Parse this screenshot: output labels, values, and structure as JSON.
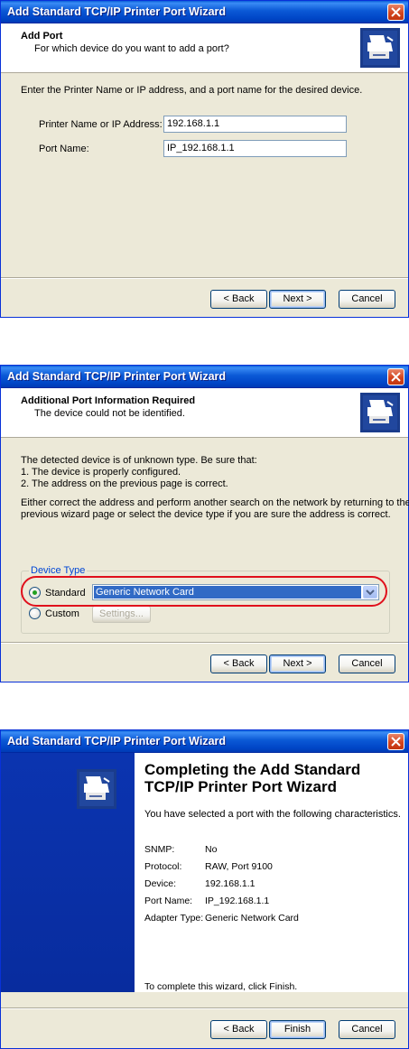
{
  "wizard_title": "Add Standard TCP/IP Printer Port Wizard",
  "step1": {
    "header_title": "Add Port",
    "header_sub": "For which device do you want to add a port?",
    "instruction": "Enter the Printer Name or IP address, and a port name for the desired device.",
    "printer_label": "Printer Name or IP Address:",
    "printer_value": "192.168.1.1",
    "port_label": "Port Name:",
    "port_value": "IP_192.168.1.1"
  },
  "step2": {
    "header_title": "Additional Port Information Required",
    "header_sub": "The device could not be identified.",
    "line1": "The detected device is of unknown type.  Be sure that:",
    "line2": "1. The device is properly configured.",
    "line3": "2.  The address on the previous page is correct.",
    "line4": "Either correct the address and perform another search on the network by returning to the",
    "line5": "previous wizard page or select the device type if you are sure the address is correct.",
    "group_label": "Device Type",
    "standard_label": "Standard",
    "standard_value": "Generic Network Card",
    "custom_label": "Custom",
    "settings_label": "Settings..."
  },
  "step3": {
    "title_line1": "Completing the Add Standard",
    "title_line2": "TCP/IP Printer Port Wizard",
    "intro": "You have selected a port with the following characteristics.",
    "rows": [
      {
        "key": "SNMP:",
        "value": "No"
      },
      {
        "key": "Protocol:",
        "value": "RAW, Port 9100"
      },
      {
        "key": "Device:",
        "value": "192.168.1.1"
      },
      {
        "key": "Port Name:",
        "value": "IP_192.168.1.1"
      },
      {
        "key": "Adapter Type:",
        "value": "Generic Network Card"
      }
    ],
    "finish_note": "To complete this wizard, click Finish."
  },
  "buttons": {
    "back": "< Back",
    "next": "Next >",
    "cancel": "Cancel",
    "finish": "Finish"
  },
  "colors": {
    "titlebar": "#0b59d6",
    "side_panel": "#0b34b0",
    "highlight": "#e0101c"
  }
}
